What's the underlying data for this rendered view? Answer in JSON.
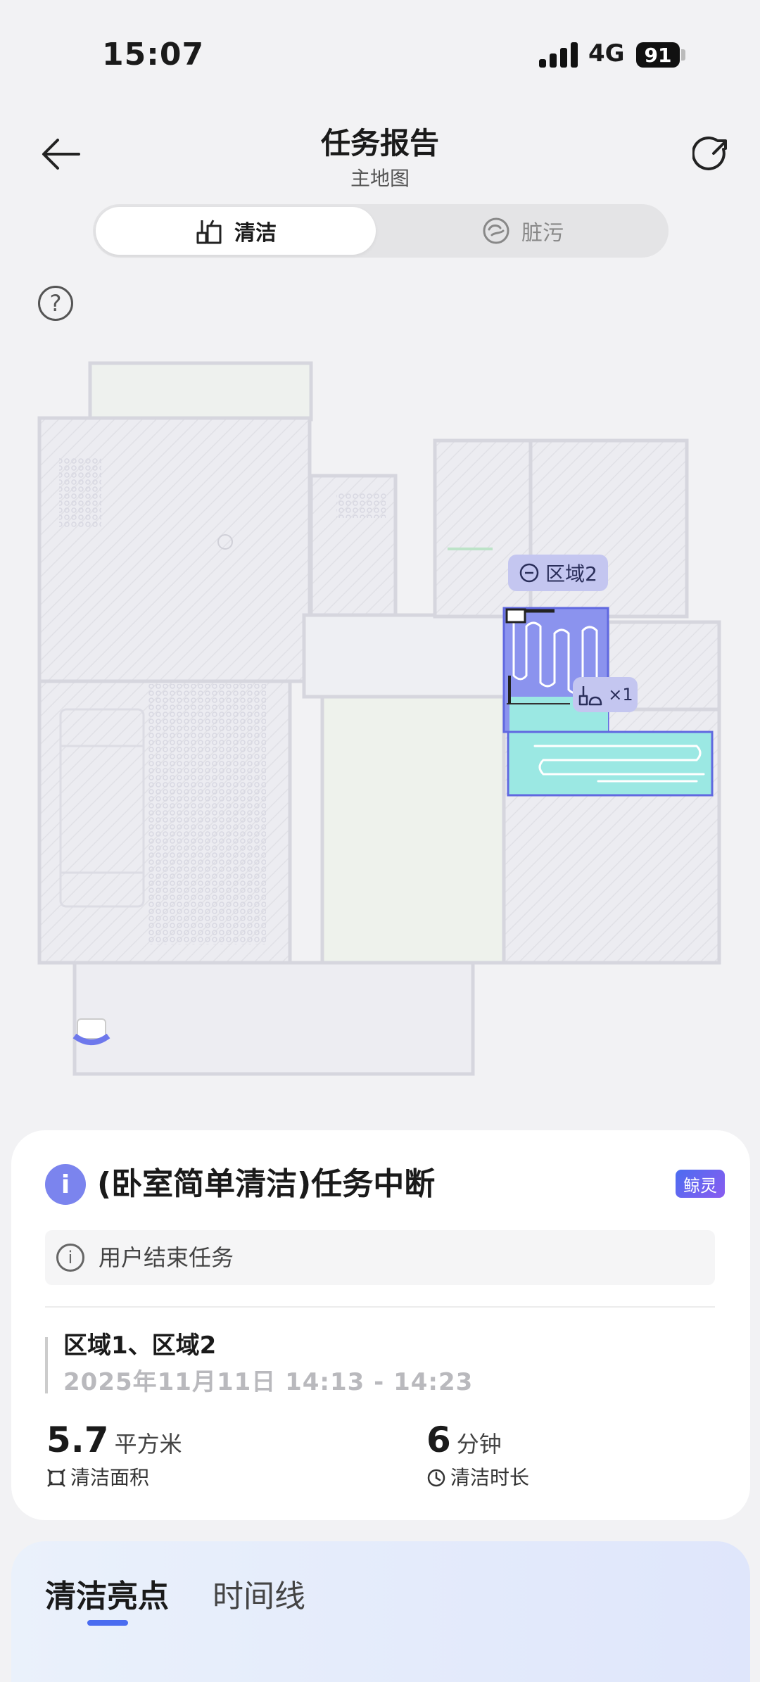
{
  "status_bar": {
    "time": "15:07",
    "network": "4G",
    "battery": "91"
  },
  "header": {
    "title": "任务报告",
    "subtitle": "主地图"
  },
  "tabs": [
    {
      "label": "清洁",
      "icon": "broom-icon",
      "active": true
    },
    {
      "label": "脏污",
      "icon": "dirt-icon",
      "active": false
    }
  ],
  "map": {
    "zone_label": "区域2",
    "clean_count": "×1",
    "colors": {
      "cleaned": "#8b93ee",
      "mopped": "#9be8e3",
      "walls": "#d6d6de",
      "floor": "#ececf1"
    }
  },
  "task": {
    "title": "(卧室简单清洁)任务中断",
    "brand": "鲸灵",
    "reason": "用户结束任务",
    "areas": "区域1、区域2",
    "time_range": "2025年11月11日 14:13 - 14:23",
    "area_value": "5.7",
    "area_unit": "平方米",
    "area_label": "清洁面积",
    "duration_value": "6",
    "duration_unit": "分钟",
    "duration_label": "清洁时长"
  },
  "bottom_tabs": [
    {
      "label": "清洁亮点",
      "active": true
    },
    {
      "label": "时间线",
      "active": false
    }
  ]
}
